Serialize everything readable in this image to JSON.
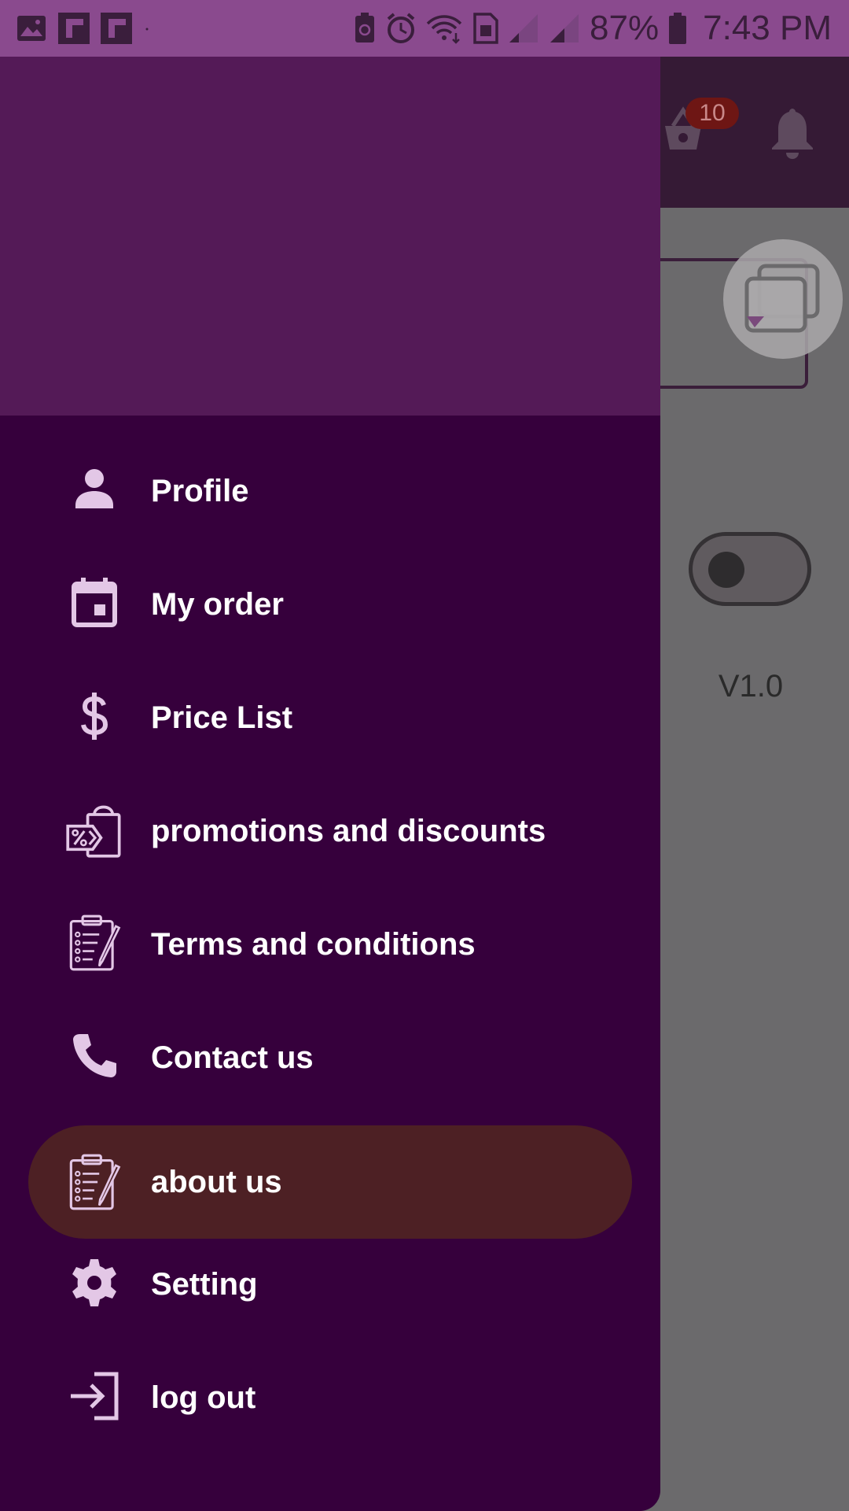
{
  "status_bar": {
    "battery_percent": "87%",
    "time": "7:43 PM",
    "left_icons": [
      "image-icon",
      "flipboard-icon",
      "flipboard-icon",
      "dot-icon"
    ],
    "right_icons": [
      "battery-saver-icon",
      "alarm-icon",
      "wifi-icon",
      "sim-icon",
      "signal-icon",
      "signal-icon",
      "battery-icon"
    ]
  },
  "app": {
    "cart_count": "10",
    "version": "V1.0"
  },
  "drawer": {
    "items": [
      {
        "label": "Profile",
        "icon": "person-icon",
        "active": false
      },
      {
        "label": "My order",
        "icon": "calendar-icon",
        "active": false
      },
      {
        "label": "Price List",
        "icon": "dollar-icon",
        "active": false
      },
      {
        "label": "promotions and discounts",
        "icon": "shopping-bag-discount-icon",
        "active": false
      },
      {
        "label": "Terms and conditions",
        "icon": "clipboard-icon",
        "active": false
      },
      {
        "label": "Contact us",
        "icon": "phone-icon",
        "active": false
      },
      {
        "label": "about us",
        "icon": "clipboard-icon",
        "active": true
      },
      {
        "label": "Setting",
        "icon": "gear-icon",
        "active": false
      },
      {
        "label": "log out",
        "icon": "logout-icon",
        "active": false
      }
    ]
  },
  "colors": {
    "drawer_bg": "#36003c",
    "drawer_header": "#541a57",
    "active_pill": "#4d2024",
    "status_bar": "#8a4a8e",
    "icon_tint": "#e3c7e6"
  }
}
